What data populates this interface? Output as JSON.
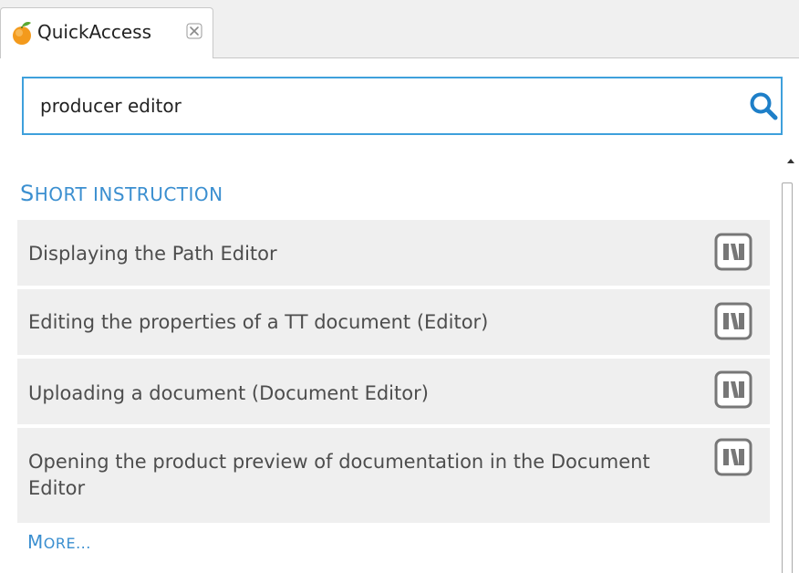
{
  "tab": {
    "label": "QuickAccess",
    "icon": "orange-icon",
    "close_icon": "close-icon"
  },
  "search": {
    "value": "producer editor",
    "icon": "search-icon",
    "accent_color": "#3ea0dc"
  },
  "section": {
    "title_first": "S",
    "title_rest": "HORT INSTRUCTION"
  },
  "results": [
    {
      "label": "Displaying the Path Editor",
      "icon": "book-icon"
    },
    {
      "label": "Editing the properties of a TT document (Editor)",
      "icon": "book-icon"
    },
    {
      "label": "Uploading a document (Document Editor)",
      "icon": "book-icon"
    },
    {
      "label": "Opening the product preview of documentation in the Document Editor",
      "icon": "book-icon"
    }
  ],
  "more": {
    "first": "M",
    "rest": "ORE..."
  },
  "colors": {
    "link": "#3b8fd0",
    "row_background": "#efefef"
  }
}
